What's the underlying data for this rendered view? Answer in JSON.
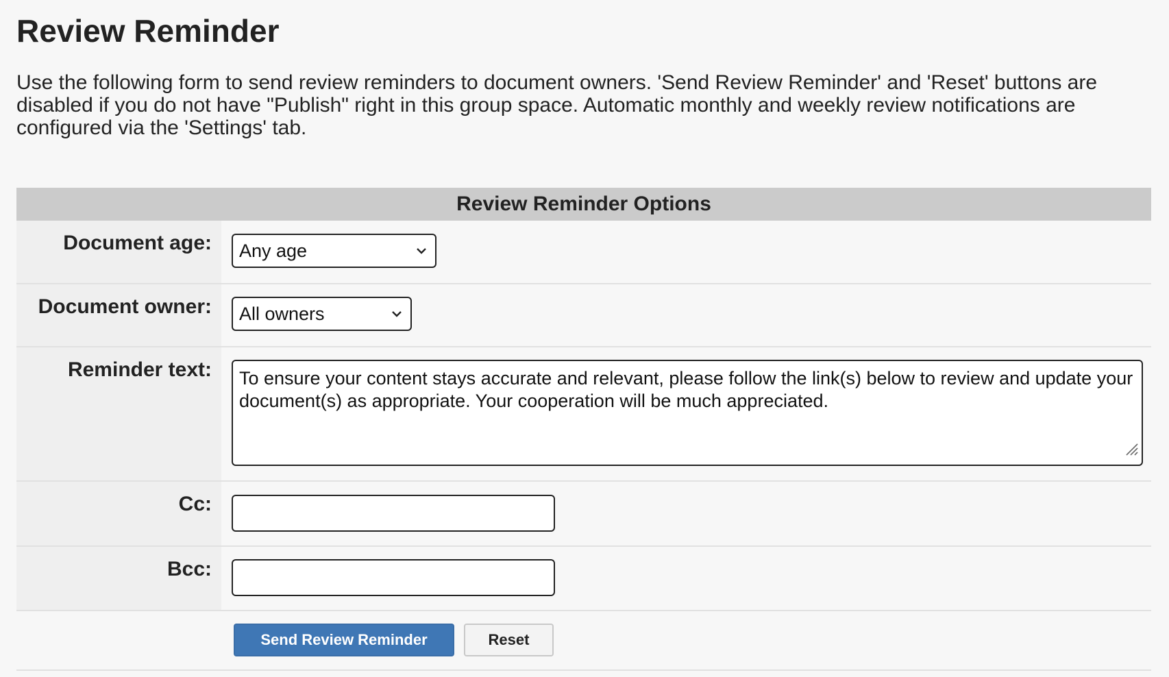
{
  "page": {
    "title": "Review Reminder",
    "intro": "Use the following form to send review reminders to document owners. 'Send Review Reminder' and 'Reset' buttons are disabled if you do not have \"Publish\" right in this group space. Automatic monthly and weekly review notifications are configured via the 'Settings' tab."
  },
  "options": {
    "header": "Review Reminder Options",
    "document_age": {
      "label": "Document age:",
      "value": "Any age"
    },
    "document_owner": {
      "label": "Document owner:",
      "value": "All owners"
    },
    "reminder_text": {
      "label": "Reminder text:",
      "value": "To ensure your content stays accurate and relevant, please follow the link(s) below to review and update your document(s) as appropriate. Your cooperation will be much appreciated."
    },
    "cc": {
      "label": "Cc:",
      "value": ""
    },
    "bcc": {
      "label": "Bcc:",
      "value": ""
    },
    "buttons": {
      "send_label": "Send Review Reminder",
      "reset_label": "Reset"
    }
  },
  "colors": {
    "primary_button": "#3f77b5",
    "header_bg": "#cbcbcb",
    "label_bg": "#efefef",
    "page_bg": "#f7f7f7"
  },
  "icons": {
    "dropdown": "chevron-down-icon",
    "resize": "resize-grip-icon"
  }
}
